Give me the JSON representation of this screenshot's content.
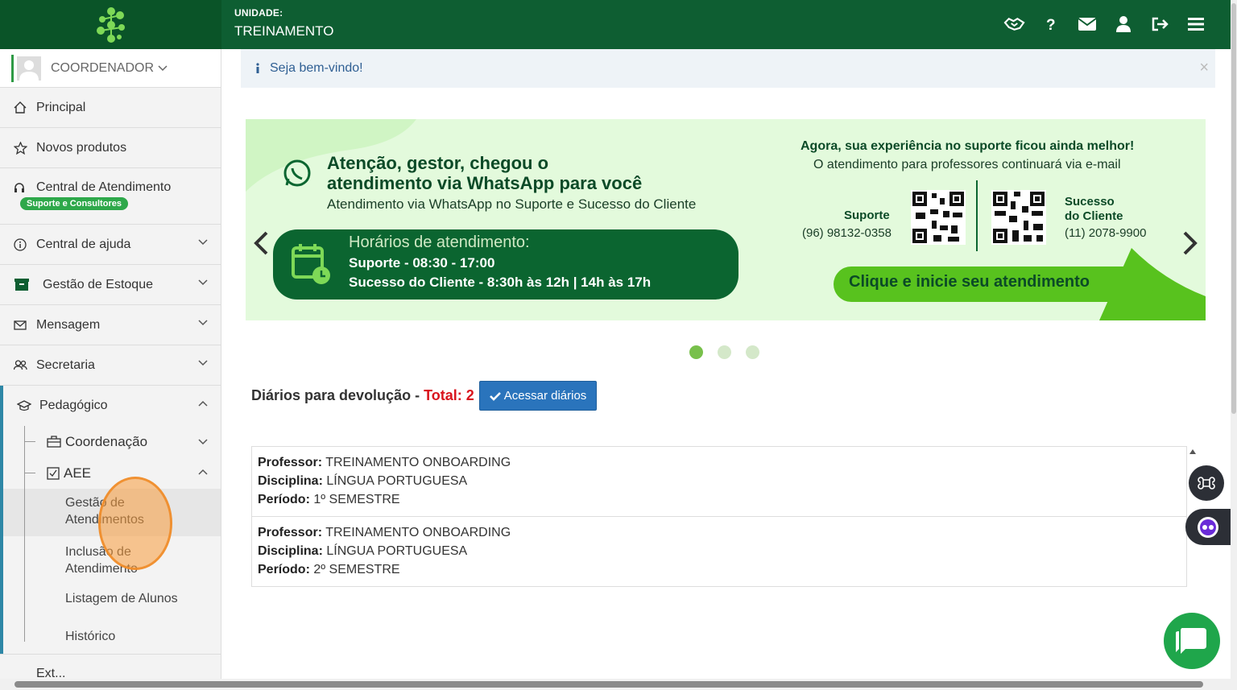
{
  "topbar": {
    "unit_label": "UNIDADE:",
    "unit_value": "TREINAMENTO"
  },
  "user": {
    "role": "COORDENADOR"
  },
  "sidebar": {
    "items": [
      {
        "label": "Principal",
        "icon": "home-icon"
      },
      {
        "label": "Novos produtos",
        "icon": "star-icon"
      },
      {
        "label": "Central de Atendimento",
        "icon": "headset-icon",
        "badge": "Suporte e Consultores"
      },
      {
        "label": "Central de ajuda",
        "icon": "info-icon"
      },
      {
        "label": "Gestão de Estoque",
        "icon": "archive-icon"
      },
      {
        "label": "Mensagem",
        "icon": "envelope-icon"
      },
      {
        "label": "Secretaria",
        "icon": "users-icon"
      },
      {
        "label": "Pedagógico",
        "icon": "graduation-icon"
      }
    ],
    "pedagogico": {
      "coordenacao": "Coordenação",
      "aee": "AEE",
      "sub": [
        "Gestão de Atendimentos",
        "Inclusão de Atendimento",
        "Listagem de Alunos",
        "Histórico"
      ]
    },
    "cut_item": "Ext..."
  },
  "welcome": {
    "text": "Seja bem-vindo!",
    "close": "×"
  },
  "banner": {
    "headline1": "Atenção, gestor, chegou o",
    "headline2": "atendimento via WhatsApp para você",
    "subline": "Atendimento via WhatsApp no Suporte e Sucesso do Cliente",
    "hours_title": "Horários de atendimento:",
    "hours_support": "Suporte - 08:30 - 17:00",
    "hours_success": "Sucesso do Cliente - 8:30h às 12h | 14h às 17h",
    "right_title": "Agora, sua experiência no suporte ficou ainda melhor!",
    "right_sub": "O atendimento para professores continuará via e-mail",
    "support_label": "Suporte",
    "support_phone": "(96) 98132-0358",
    "success_label1": "Sucesso",
    "success_label2": "do Cliente",
    "success_phone": "(11) 2078-9900",
    "cta": "Clique e inicie seu atendimento"
  },
  "diarios": {
    "title": "Diários para devolução - ",
    "total": "Total: 2",
    "button": "Acessar diários"
  },
  "diary_rows": [
    {
      "prof_label": "Professor:",
      "prof": "TREINAMENTO ONBOARDING",
      "disc_label": "Disciplina:",
      "disc": "LÍNGUA PORTUGUESA",
      "per_label": "Período:",
      "per": "1º SEMESTRE"
    },
    {
      "prof_label": "Professor:",
      "prof": "TREINAMENTO ONBOARDING",
      "disc_label": "Disciplina:",
      "disc": "LÍNGUA PORTUGUESA",
      "per_label": "Período:",
      "per": "2º SEMESTRE"
    }
  ],
  "colors": {
    "brand_green": "#0e5e32",
    "accent_blue": "#2a74bc",
    "total_red": "#d9141d"
  }
}
